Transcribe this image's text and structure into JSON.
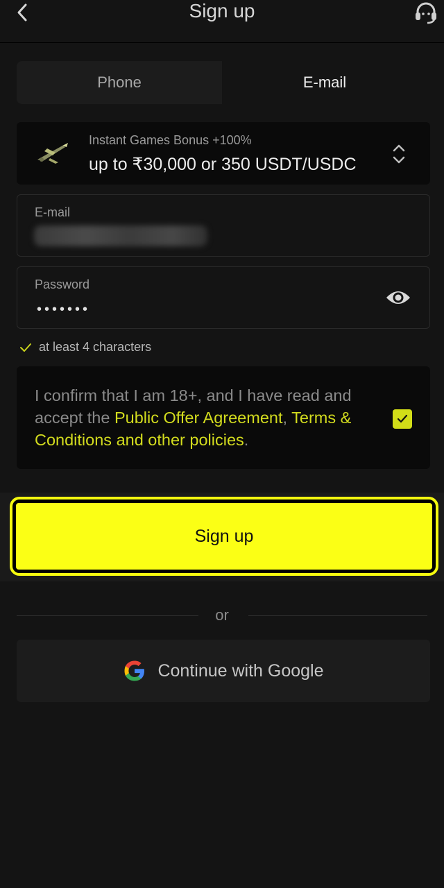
{
  "header": {
    "title": "Sign up",
    "back_icon": "chevron-left-icon",
    "support_icon": "headset-icon"
  },
  "tabs": [
    {
      "label": "Phone",
      "active": false
    },
    {
      "label": "E-mail",
      "active": true
    }
  ],
  "bonus": {
    "subtitle": "Instant Games Bonus +100%",
    "main": "up to ₹30,000 or 350 USDT/USDC",
    "icon": "airplane-icon",
    "selector_icon": "up-down-chevron-icon"
  },
  "email": {
    "label": "E-mail",
    "value_obscured": true
  },
  "password": {
    "label": "Password",
    "value": "•••••••",
    "toggle_icon": "eye-icon"
  },
  "hint": {
    "text": "at least 4 characters"
  },
  "consent": {
    "text_part1": "I confirm that I am 18+, and I have read and accept the ",
    "link1": "Public Offer Agreement",
    "sep": ", ",
    "link2": "Terms & Conditions and other policies",
    "end": ".",
    "checked": true
  },
  "signup": {
    "label": "Sign up"
  },
  "divider": {
    "label": "or"
  },
  "google": {
    "label": "Continue with Google",
    "icon": "google-icon"
  },
  "colors": {
    "background": "#141414",
    "accent": "#fbff15",
    "link": "#d3dc1e",
    "check": "#d2dd18"
  }
}
